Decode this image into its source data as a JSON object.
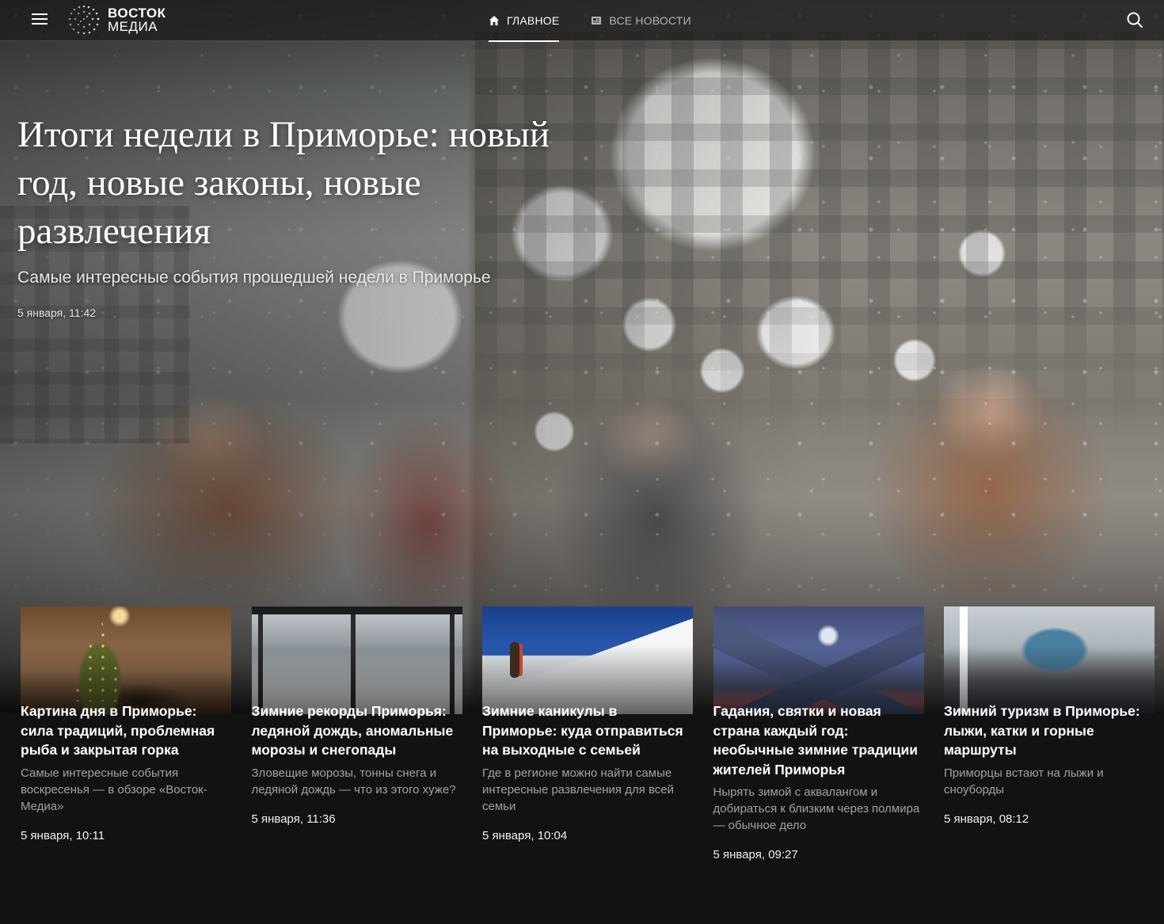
{
  "header": {
    "logo_line1": "ВОСТОК",
    "logo_line2": "МЕДИА",
    "nav": [
      {
        "label": "ГЛАВНОЕ",
        "icon": "home-icon",
        "active": true
      },
      {
        "label": "ВСЕ НОВОСТИ",
        "icon": "newspaper-icon",
        "active": false
      }
    ]
  },
  "hero": {
    "title": "Итоги недели в Приморье: новый год, новые законы, новые развлечения",
    "subtitle": "Самые интересные события прошедшей недели в Приморье",
    "date": "5 января, 11:42"
  },
  "cards": [
    {
      "title": "Картина дня в Приморье: сила традиций, проблемная рыба и закрытая горка",
      "desc": "Самые интересные события воскресенья — в обзоре «Восток-Медиа»",
      "date": "5 января, 10:11"
    },
    {
      "title": "Зимние рекорды Приморья: ледяной дождь, аномальные морозы и снегопады",
      "desc": "Зловещие морозы, тонны снега и ледяной дождь — что из этого хуже?",
      "date": "5 января, 11:36"
    },
    {
      "title": "Зимние каникулы в Приморье: куда отправиться на выходные с семьей",
      "desc": "Где в регионе можно найти самые интересные развлечения для всей семьи",
      "date": "5 января, 10:04"
    },
    {
      "title": "Гадания, святки и новая страна каждый год: необычные зимние традиции жителей Приморья",
      "desc": "Нырять зимой с аквалангом и добираться к близким через полмира — обычное дело",
      "date": "5 января, 09:27"
    },
    {
      "title": "Зимний туризм в Приморье: лыжи, катки и горные маршруты",
      "desc": "Приморцы встают на лыжи и сноуборды",
      "date": "5 января, 08:12"
    }
  ]
}
